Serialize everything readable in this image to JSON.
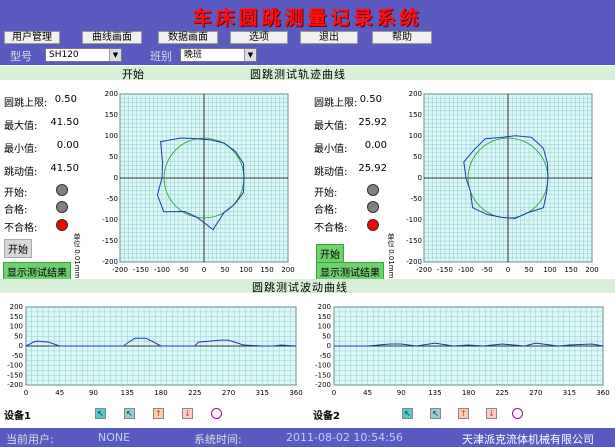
{
  "app": {
    "title": "车床圆跳测量记录系统"
  },
  "menu": {
    "items": [
      "用户管理",
      "曲线画面",
      "数据画面",
      "选项",
      "退出",
      "帮助"
    ]
  },
  "selectors": {
    "model_label": "型号",
    "model_value": "SH120",
    "shift_label": "班别",
    "shift_value": "晚班"
  },
  "trace_header": {
    "start_label": "开始",
    "title": "圆跳测试轨迹曲线"
  },
  "wave_header": {
    "title": "圆跳测试波动曲线"
  },
  "devices": [
    {
      "upper_limit_label": "圆跳上限:",
      "upper_limit_value": "0.50",
      "max_label": "最大值:",
      "max_value": "41.50",
      "min_label": "最小值:",
      "min_value": "0.00",
      "runout_label": "跳动值:",
      "runout_value": "41.50",
      "start_label": "开始:",
      "pass_label": "合格:",
      "fail_label": "不合格:",
      "start_button": "开始",
      "show_result_button": "显示测试结果",
      "unit_label": "单位 0.01mm",
      "name": "设备1",
      "lights": {
        "start": "#808080",
        "pass": "#808080",
        "fail": "#ff0000"
      }
    },
    {
      "upper_limit_label": "圆跳上限:",
      "upper_limit_value": "0.50",
      "max_label": "最大值:",
      "max_value": "25.92",
      "min_label": "最小值:",
      "min_value": "0.00",
      "runout_label": "跳动值:",
      "runout_value": "25.92",
      "start_label": "开始:",
      "pass_label": "合格:",
      "fail_label": "不合格:",
      "start_button": "开始",
      "show_result_button": "显示测试结果",
      "unit_label": "单位 0.01mm",
      "name": "设备2",
      "lights": {
        "start": "#808080",
        "pass": "#808080",
        "fail": "#ff0000"
      }
    }
  ],
  "polar_axis": {
    "ticks": [
      "-200",
      "-150",
      "-100",
      "-50",
      "0",
      "50",
      "100",
      "150",
      "200"
    ]
  },
  "wave_axis": {
    "x_ticks": [
      "0",
      "45",
      "90",
      "135",
      "180",
      "225",
      "270",
      "315",
      "360"
    ],
    "y_ticks": [
      "200",
      "150",
      "100",
      "50",
      "0",
      "-50",
      "-100",
      "-150",
      "-200"
    ]
  },
  "chart_data": [
    {
      "type": "line",
      "title": "圆跳测试轨迹曲线",
      "device": "设备1",
      "xlim": [
        -200,
        200
      ],
      "ylim": [
        -200,
        200
      ],
      "grid": true,
      "polar_points": {
        "angle_deg": [
          0,
          20,
          40,
          60,
          80,
          100,
          120,
          140,
          160,
          180,
          200,
          220,
          240,
          260,
          280,
          300,
          320,
          340
        ],
        "radius": [
          95,
          100,
          98,
          96,
          92,
          95,
          110,
          135,
          105,
          100,
          118,
          125,
          92,
          95,
          125,
          95,
          96,
          100
        ]
      }
    },
    {
      "type": "line",
      "title": "圆跳测试轨迹曲线",
      "device": "设备2",
      "xlim": [
        -200,
        200
      ],
      "ylim": [
        -200,
        200
      ],
      "grid": true,
      "polar_points": {
        "angle_deg": [
          0,
          20,
          40,
          60,
          80,
          100,
          120,
          140,
          160,
          180,
          200,
          220,
          240,
          260,
          280,
          300,
          320,
          340
        ],
        "radius": [
          95,
          100,
          110,
          112,
          102,
          98,
          108,
          105,
          112,
          100,
          95,
          110,
          100,
          95,
          98,
          95,
          110,
          98
        ]
      }
    },
    {
      "type": "line",
      "title": "圆跳测试波动曲线",
      "device": "设备1",
      "xlim": [
        0,
        360
      ],
      "ylim": [
        -200,
        200
      ],
      "grid": true,
      "x": [
        0,
        10,
        15,
        30,
        45,
        90,
        130,
        135,
        145,
        160,
        180,
        200,
        225,
        230,
        260,
        270,
        290,
        315,
        330,
        340,
        360
      ],
      "y": [
        0,
        20,
        25,
        20,
        0,
        0,
        0,
        15,
        40,
        40,
        0,
        0,
        0,
        20,
        30,
        30,
        5,
        0,
        0,
        5,
        0
      ]
    },
    {
      "type": "line",
      "title": "圆跳测试波动曲线",
      "device": "设备2",
      "xlim": [
        0,
        360
      ],
      "ylim": [
        -200,
        200
      ],
      "grid": true,
      "x": [
        0,
        20,
        45,
        75,
        90,
        110,
        135,
        160,
        180,
        200,
        225,
        255,
        270,
        300,
        315,
        345,
        360
      ],
      "y": [
        0,
        0,
        0,
        10,
        10,
        0,
        15,
        0,
        5,
        0,
        10,
        0,
        15,
        0,
        5,
        10,
        0
      ]
    }
  ],
  "status": {
    "user_label": "当前用户:",
    "user_value": "NONE",
    "time_label": "系统时间:",
    "time_value": "2011-08-02 10:54:56",
    "company": "天津派克流体机械有限公司"
  },
  "colors": {
    "title_bar": "#5a5ac0",
    "title_text": "#ff1010",
    "grid": "#7fd4d4",
    "plot_bg": "#e0f6f6",
    "trace": "#1f38a8",
    "reference_circle": "#20a020"
  }
}
